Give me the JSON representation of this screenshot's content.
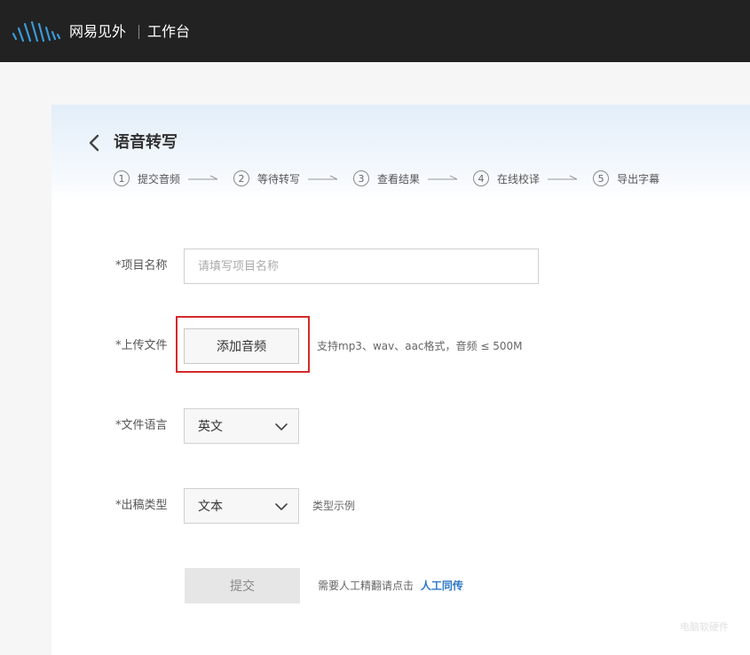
{
  "header": {
    "brand_name": "网易见外",
    "brand_sub": "工作台"
  },
  "page": {
    "title": "语音转写",
    "steps": [
      {
        "num": "1",
        "label": "提交音频"
      },
      {
        "num": "2",
        "label": "等待转写"
      },
      {
        "num": "3",
        "label": "查看结果"
      },
      {
        "num": "4",
        "label": "在线校译"
      },
      {
        "num": "5",
        "label": "导出字幕"
      }
    ]
  },
  "form": {
    "project_name": {
      "label": "*项目名称",
      "placeholder": "请填写项目名称",
      "value": ""
    },
    "upload": {
      "label": "*上传文件",
      "button_label": "添加音频",
      "hint": "支持mp3、wav、aac格式，音频 ≤ 500M"
    },
    "language": {
      "label": "*文件语言",
      "selected": "英文"
    },
    "output_type": {
      "label": "*出稿类型",
      "selected": "文本",
      "example_link": "类型示例"
    },
    "submit": {
      "label": "提交",
      "hint_prefix": "需要人工精翻请点击",
      "hint_link": "人工同传"
    }
  },
  "watermark": "电脑软硬件",
  "colors": {
    "topbar": "#222222",
    "highlight": "#d42a2a",
    "link": "#2d78c8",
    "logo_blue": "#3a9ad9"
  }
}
